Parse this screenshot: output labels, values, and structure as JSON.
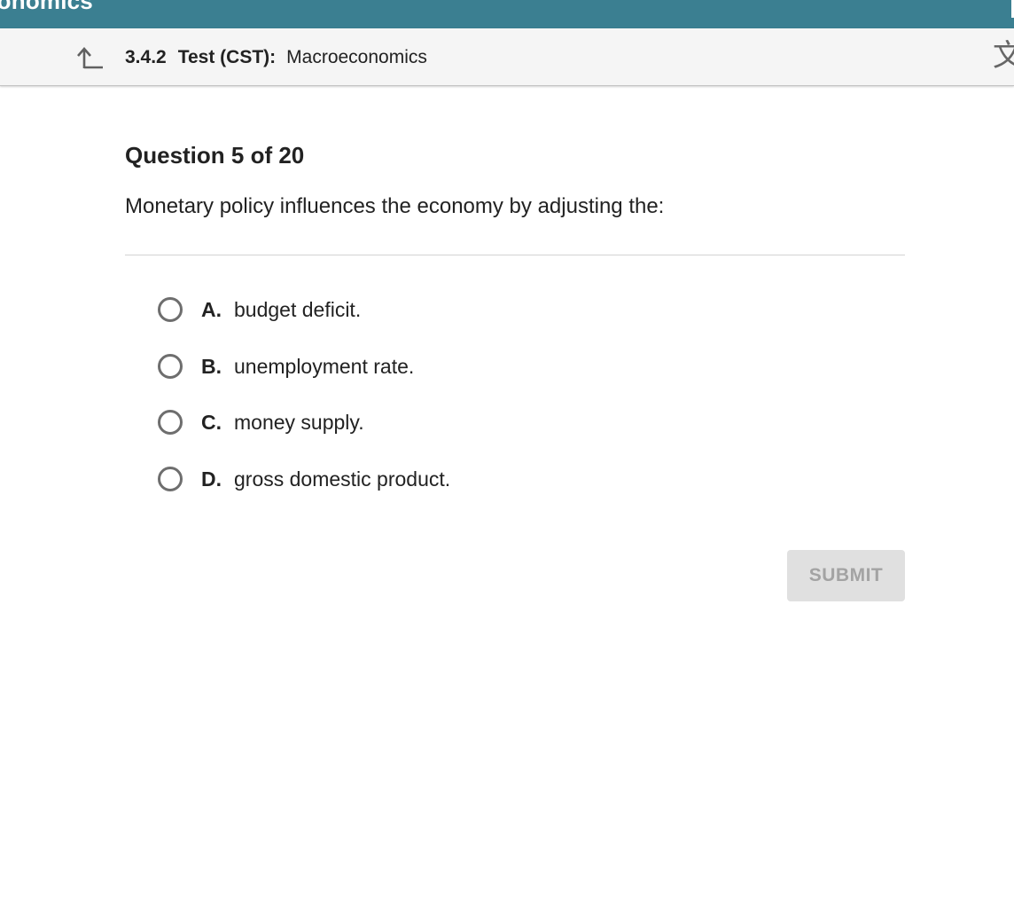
{
  "topbar": {
    "title": "conomics",
    "color": "#3b7f91"
  },
  "header": {
    "back_icon": "back-up-arrow-icon",
    "test_code": "3.4.2",
    "test_type": "Test (CST):",
    "course": "Macroeconomics",
    "translate_icon": "translate-icon",
    "translate_glyph": "文"
  },
  "question": {
    "number_label": "Question 5 of 20",
    "prompt": "Monetary policy influences the economy by adjusting the:",
    "choices": [
      {
        "letter": "A.",
        "text": "budget deficit."
      },
      {
        "letter": "B.",
        "text": "unemployment rate."
      },
      {
        "letter": "C.",
        "text": "money supply."
      },
      {
        "letter": "D.",
        "text": "gross domestic product."
      }
    ]
  },
  "actions": {
    "submit_label": "SUBMIT"
  }
}
